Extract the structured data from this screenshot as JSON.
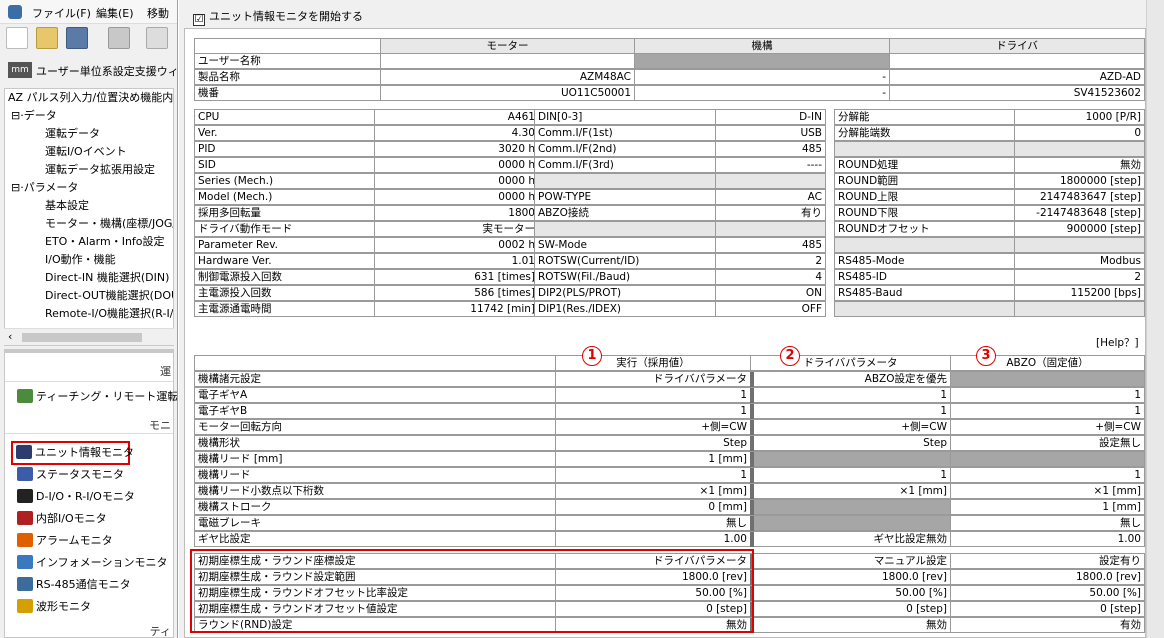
{
  "menu": {
    "file": "ファイル(F)",
    "edit": "編集(E)",
    "move": "移動"
  },
  "toolbar2": {
    "label": "ユーザー単位系設定支援ウィ"
  },
  "tree": {
    "root": "AZ パルス列入力/位置決め機能内",
    "items": [
      {
        "label": "データ",
        "level": 0
      },
      {
        "label": "運転データ",
        "level": 2
      },
      {
        "label": "運転I/Oイベント",
        "level": 2
      },
      {
        "label": "運転データ拡張用設定",
        "level": 2
      },
      {
        "label": "パラメータ",
        "level": 0
      },
      {
        "label": "基本設定",
        "level": 2
      },
      {
        "label": "モーター・機構(座標/JOG/",
        "level": 2
      },
      {
        "label": "ETO・Alarm・Info設定",
        "level": 2
      },
      {
        "label": "I/O動作・機能",
        "level": 2
      },
      {
        "label": "Direct-IN 機能選択(DIN)",
        "level": 2
      },
      {
        "label": "Direct-OUT機能選択(DOU",
        "level": 2
      },
      {
        "label": "Remote-I/O機能選択(R-I/",
        "level": 2
      }
    ]
  },
  "nav": {
    "group1": "運",
    "teaching": "ティーチング・リモート運転",
    "group2": "モニ",
    "items": [
      "ユニット情報モニタ",
      "ステータスモニタ",
      "D-I/O・R-I/Oモニタ",
      "内部I/Oモニタ",
      "アラームモニタ",
      "インフォメーションモニタ",
      "RS-485通信モニタ",
      "波形モニタ"
    ],
    "group3": "ティ"
  },
  "monitor_checkbox": {
    "label": "ユニット情報モニタを開始する",
    "checked": "☑"
  },
  "info_table": {
    "headers": [
      "モーター",
      "機構",
      "ドライバ"
    ],
    "rows": [
      {
        "label": "ユーザー名称",
        "motor": "",
        "mech": "",
        "driver": ""
      },
      {
        "label": "製品名称",
        "motor": "AZM48AC",
        "mech": "-",
        "driver": "AZD-AD"
      },
      {
        "label": "機番",
        "motor": "UO11C50001",
        "mech": "-",
        "driver": "SV41523602"
      }
    ]
  },
  "status_col1": [
    {
      "k": "CPU",
      "v": "A461"
    },
    {
      "k": "Ver.",
      "v": "4.30"
    },
    {
      "k": "PID",
      "v": "3020 h"
    },
    {
      "k": "SID",
      "v": "0000 h"
    },
    {
      "k": "Series (Mech.)",
      "v": "0000 h"
    },
    {
      "k": "Model (Mech.)",
      "v": "0000 h"
    },
    {
      "k": "採用多回転量",
      "v": "1800"
    },
    {
      "k": "ドライバ動作モード",
      "v": "実モーター"
    },
    {
      "k": "Parameter Rev.",
      "v": "0002 h"
    },
    {
      "k": "Hardware Ver.",
      "v": "1.01"
    },
    {
      "k": "制御電源投入回数",
      "v": "631 [times]"
    },
    {
      "k": "主電源投入回数",
      "v": "586 [times]"
    },
    {
      "k": "主電源通電時間",
      "v": "11742 [min]"
    }
  ],
  "status_col2": [
    {
      "k": "DIN[0-3]",
      "v": "D-IN"
    },
    {
      "k": "Comm.I/F(1st)",
      "v": "USB"
    },
    {
      "k": "Comm.I/F(2nd)",
      "v": "485"
    },
    {
      "k": "Comm.I/F(3rd)",
      "v": "----"
    },
    {
      "k": "",
      "v": ""
    },
    {
      "k": "POW-TYPE",
      "v": "AC"
    },
    {
      "k": "ABZO接続",
      "v": "有り"
    },
    {
      "k": "",
      "v": ""
    },
    {
      "k": "SW-Mode",
      "v": "485"
    },
    {
      "k": "ROTSW(Current/ID)",
      "v": "2"
    },
    {
      "k": "ROTSW(Fil./Baud)",
      "v": "4"
    },
    {
      "k": "DIP2(PLS/PROT)",
      "v": "ON"
    },
    {
      "k": "DIP1(Res./IDEX)",
      "v": "OFF"
    }
  ],
  "status_col3": [
    {
      "k": "分解能",
      "v": "1000 [P/R]"
    },
    {
      "k": "分解能端数",
      "v": "0"
    },
    {
      "k": "",
      "v": ""
    },
    {
      "k": "ROUND処理",
      "v": "無効"
    },
    {
      "k": "ROUND範囲",
      "v": "1800000 [step]"
    },
    {
      "k": "ROUND上限",
      "v": "2147483647 [step]"
    },
    {
      "k": "ROUND下限",
      "v": "-2147483648 [step]"
    },
    {
      "k": "ROUNDオフセット",
      "v": "900000 [step]"
    },
    {
      "k": "",
      "v": ""
    },
    {
      "k": "RS485-Mode",
      "v": "Modbus"
    },
    {
      "k": "RS485-ID",
      "v": "2"
    },
    {
      "k": "RS485-Baud",
      "v": "115200 [bps]"
    },
    {
      "k": "",
      "v": ""
    }
  ],
  "help": "[Help？]",
  "params": {
    "badges": [
      "1",
      "2",
      "3"
    ],
    "headers": [
      "実行（採用値）",
      "ドライバパラメータ",
      "ABZO（固定値）"
    ],
    "rows": [
      {
        "label": "機構諸元設定",
        "v1": "ドライバパラメータ",
        "v2": "ABZO設定を優先",
        "v3": ""
      },
      {
        "label": "電子ギヤA",
        "v1": "1",
        "v2": "1",
        "v3": "1"
      },
      {
        "label": "電子ギヤB",
        "v1": "1",
        "v2": "1",
        "v3": "1"
      },
      {
        "label": "モーター回転方向",
        "v1": "+側=CW",
        "v2": "+側=CW",
        "v3": "+側=CW"
      },
      {
        "label": "機構形状",
        "v1": "Step",
        "v2": "Step",
        "v3": "設定無し"
      },
      {
        "label": "機構リード [mm]",
        "v1": "1 [mm]",
        "v2": "",
        "v3": ""
      },
      {
        "label": "機構リード",
        "v1": "1",
        "v2": "1",
        "v3": "1"
      },
      {
        "label": "機構リード小数点以下桁数",
        "v1": "×1 [mm]",
        "v2": "×1 [mm]",
        "v3": "×1 [mm]"
      },
      {
        "label": "機構ストローク",
        "v1": "0 [mm]",
        "v2": "",
        "v3": "1 [mm]"
      },
      {
        "label": "電磁ブレーキ",
        "v1": "無し",
        "v2": "",
        "v3": "無し"
      },
      {
        "label": "ギヤ比設定",
        "v1": "1.00",
        "v2": "ギヤ比設定無効",
        "v3": "1.00"
      },
      {
        "label": "初期座標生成・ラウンド座標設定",
        "v1": "ドライバパラメータ",
        "v2": "マニュアル設定",
        "v3": "設定有り"
      },
      {
        "label": "初期座標生成・ラウンド設定範囲",
        "v1": "1800.0 [rev]",
        "v2": "1800.0 [rev]",
        "v3": "1800.0 [rev]"
      },
      {
        "label": "初期座標生成・ラウンドオフセット比率設定",
        "v1": "50.00 [%]",
        "v2": "50.00 [%]",
        "v3": "50.00 [%]"
      },
      {
        "label": "初期座標生成・ラウンドオフセット値設定",
        "v1": "0 [step]",
        "v2": "0 [step]",
        "v3": "0 [step]"
      },
      {
        "label": "ラウンド(RND)設定",
        "v1": "無効",
        "v2": "無効",
        "v3": "有効"
      }
    ]
  }
}
